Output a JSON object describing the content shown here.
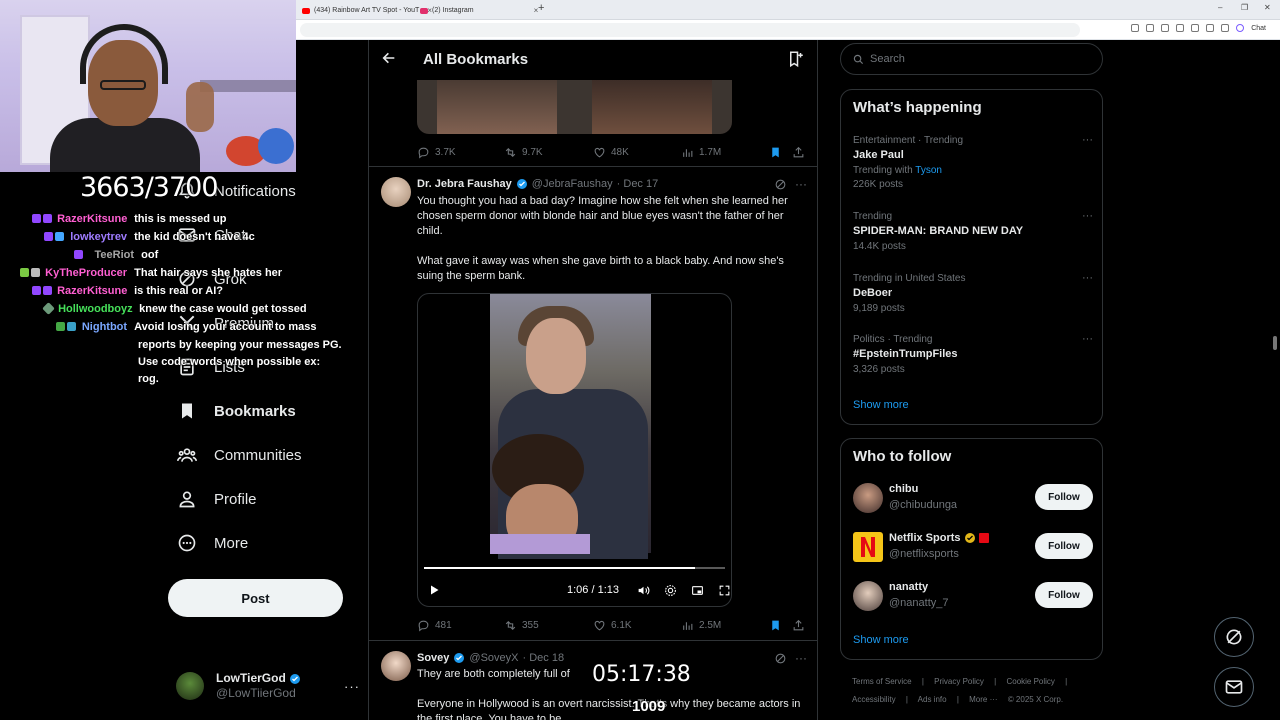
{
  "browser": {
    "tabs": [
      {
        "title": "(434) Rainbow Art TV Spot - YouT",
        "close": "×",
        "color": "#ff0000"
      },
      {
        "title": "(2) Instagram",
        "close": "×",
        "color": "#e1306c"
      }
    ],
    "new_tab": "+",
    "toolbar_chat": "Chat"
  },
  "overlay": {
    "counter": "3663/3700",
    "chat": [
      {
        "user": "RazerKitsune",
        "user_color": "#ff5fd2",
        "message": "this is messed up"
      },
      {
        "user": "lowkeytrev",
        "user_color": "#9f7cff",
        "message": "the kid doesn't have 4c"
      },
      {
        "user": "TeeRiot",
        "user_color": "#a6a6a6",
        "message": "oof"
      },
      {
        "user": "KyTheProducer",
        "user_color": "#ff5fd2",
        "message": "That hair says she hates her"
      },
      {
        "user": "RazerKitsune",
        "user_color": "#ff5fd2",
        "message": "is this real or AI?"
      },
      {
        "user": "Hollwoodboyz",
        "user_color": "#46e05a",
        "message": "knew the case would get tossed"
      },
      {
        "user": "Nightbot",
        "user_color": "#7aa7ff",
        "message": "Avoid losing your account to mass"
      },
      {
        "user": "",
        "user_color": "#ffffff",
        "message": "reports by keeping your messages PG."
      },
      {
        "user": "",
        "user_color": "#ffffff",
        "message": "Use code words when possible ex:"
      },
      {
        "user": "",
        "user_color": "#ffffff",
        "message": "rog."
      }
    ],
    "timer": "05:17:38",
    "viewers": "1009"
  },
  "sidebar": {
    "items": [
      {
        "label": "Notifications",
        "icon": "bell-icon"
      },
      {
        "label": "Chat",
        "icon": "mail-icon"
      },
      {
        "label": "Grok",
        "icon": "grok-icon"
      },
      {
        "label": "Premium",
        "icon": "x-logo-icon"
      },
      {
        "label": "Lists",
        "icon": "list-icon"
      },
      {
        "label": "Bookmarks",
        "icon": "bookmark-icon"
      },
      {
        "label": "Communities",
        "icon": "communities-icon"
      },
      {
        "label": "Profile",
        "icon": "profile-icon"
      },
      {
        "label": "More",
        "icon": "more-circle-icon"
      }
    ],
    "post_label": "Post",
    "account": {
      "display_name": "LowTierGod",
      "handle": "@LowTiierGod",
      "more": "···"
    }
  },
  "main": {
    "title": "All Bookmarks",
    "tweets": [
      {
        "stats": {
          "replies": "3.7K",
          "reposts": "9.7K",
          "likes": "48K",
          "views": "1.7M"
        }
      },
      {
        "name": "Dr. Jebra Faushay",
        "handle": "@JebraFaushay",
        "date": "· Dec 17",
        "text1": "You thought you had a bad day? Imagine how she felt when she learned her chosen sperm donor with blonde hair and blue eyes wasn't the father of her child.",
        "text2": "What gave it away was when she gave birth to a black baby. And now she's suing the sperm bank.",
        "video": {
          "time": "1:06 / 1:13",
          "progress_percent": 90
        },
        "stats": {
          "replies": "481",
          "reposts": "355",
          "likes": "6.1K",
          "views": "2.5M"
        }
      },
      {
        "name": "Sovey",
        "handle": "@SoveyX",
        "date": "· Dec 18",
        "text1": "They are both completely full of",
        "text2": "Everyone in Hollywood is an overt narcissist. That's why they became actors in the first place. You have to be"
      }
    ]
  },
  "right": {
    "search_placeholder": "Search",
    "happening": {
      "title": "What’s happening",
      "trends": [
        {
          "meta": "Entertainment · Trending",
          "topic": "Jake Paul",
          "with_label": "Trending with",
          "with_link": "Tyson",
          "posts": "226K posts"
        },
        {
          "meta": "Trending",
          "topic": "SPIDER-MAN: BRAND NEW DAY",
          "posts": "14.4K posts"
        },
        {
          "meta": "Trending in United States",
          "topic": "DeBoer",
          "posts": "9,189 posts"
        },
        {
          "meta": "Politics · Trending",
          "topic": "#EpsteinTrumpFiles",
          "posts": "3,326 posts"
        }
      ],
      "show_more": "Show more"
    },
    "who_to_follow": {
      "title": "Who to follow",
      "users": [
        {
          "name": "chibu",
          "handle": "@chibudunga",
          "follow": "Follow"
        },
        {
          "name": "Netflix Sports",
          "handle": "@netflixsports",
          "follow": "Follow"
        },
        {
          "name": "nanatty",
          "handle": "@nanatty_7",
          "follow": "Follow"
        }
      ],
      "show_more": "Show more"
    },
    "footer": {
      "line1": [
        "Terms of Service",
        "|",
        "Privacy Policy",
        "|",
        "Cookie Policy",
        "|"
      ],
      "line2": [
        "Accessibility",
        "|",
        "Ads info",
        "|",
        "More ···",
        "© 2025 X Corp."
      ]
    }
  },
  "colors": {
    "accent": "#1d9bf0",
    "background": "#000000",
    "border": "#2f3336",
    "muted": "#71767b"
  }
}
